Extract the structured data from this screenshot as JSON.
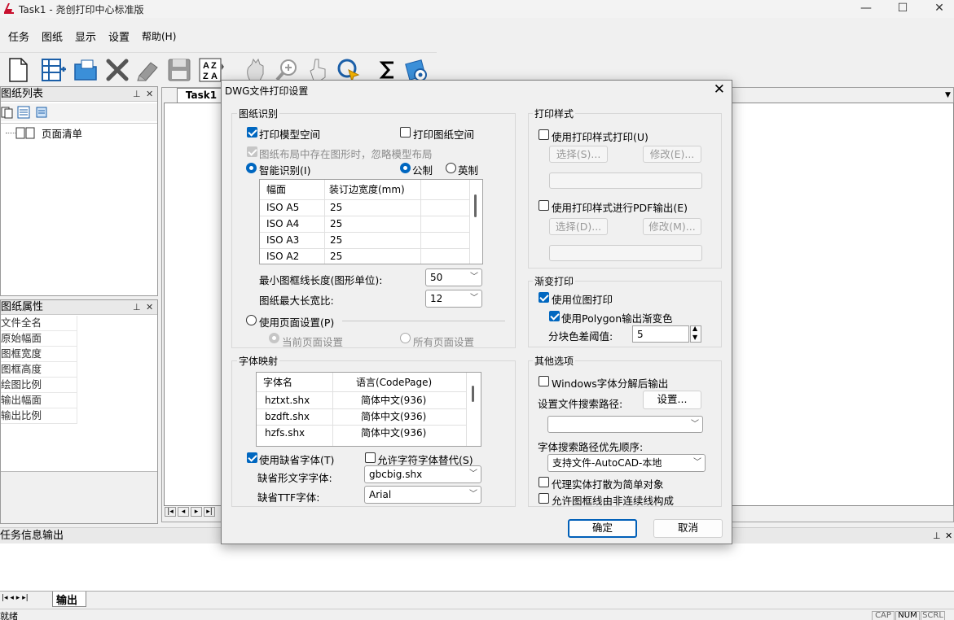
{
  "window": {
    "title": "Task1 - 尧创打印中心标准版",
    "minimize": "—",
    "maximize": "☐",
    "close": "✕"
  },
  "menu": [
    "任务",
    "图纸",
    "显示",
    "设置",
    "帮助(H)"
  ],
  "toolbar": {
    "icons": [
      "new-icon",
      "add-drawing-icon",
      "open-folder-icon",
      "delete-icon",
      "edit-icon",
      "save-icon",
      "sort-az-icon",
      "hand-icon",
      "zoom-in-icon",
      "pointer-icon",
      "select-icon",
      "sum-icon",
      "print-icon"
    ],
    "sort_label": "A Z"
  },
  "left_panel": {
    "title": "图纸列表",
    "pin": "⊥",
    "close": "✕",
    "tree_item": "页面清单"
  },
  "props_panel": {
    "title": "图纸属性",
    "pin": "⊥",
    "close": "✕",
    "rows": [
      "文件全名",
      "原始幅面",
      "图框宽度",
      "图框高度",
      "绘图比例",
      "输出幅面",
      "输出比例"
    ]
  },
  "doc": {
    "tab": "Task1"
  },
  "output": {
    "title": "任务信息输出",
    "tab": "输出",
    "pin": "⊥",
    "close": "✕"
  },
  "status": {
    "text": "就绪",
    "cells": [
      "CAP",
      "NUM",
      "SCRL"
    ]
  },
  "dialog": {
    "title": "DWG文件打印设置",
    "close": "✕",
    "recog": {
      "label": "图纸识别",
      "model_space": "打印模型空间",
      "paper_space": "打印图纸空间",
      "ignore_model": "图纸布局中存在图形时，忽略模型布局",
      "smart": "智能识别(I)",
      "metric": "公制",
      "imperial": "英制",
      "table_headers": [
        "幅面",
        "装订边宽度(mm)"
      ],
      "table_rows": [
        {
          "size": "ISO A5",
          "width": "25"
        },
        {
          "size": "ISO A4",
          "width": "25"
        },
        {
          "size": "ISO A3",
          "width": "25"
        },
        {
          "size": "ISO A2",
          "width": "25"
        }
      ],
      "min_frame_label": "最小图框线长度(图形单位):",
      "min_frame_value": "50",
      "max_ratio_label": "图纸最大长宽比:",
      "max_ratio_value": "12",
      "use_page_setup": "使用页面设置(P)",
      "current_page": "当前页面设置",
      "all_pages": "所有页面设置"
    },
    "font": {
      "label": "字体映射",
      "headers": [
        "字体名",
        "语言(CodePage)"
      ],
      "rows": [
        {
          "name": "hztxt.shx",
          "lang": "简体中文(936)"
        },
        {
          "name": "bzdft.shx",
          "lang": "简体中文(936)"
        },
        {
          "name": "hzfs.shx",
          "lang": "简体中文(936)"
        }
      ],
      "use_default": "使用缺省字体(T)",
      "allow_replace": "允许字符字体替代(S)",
      "default_shape_label": "缺省形文字字体:",
      "default_shape_value": "gbcbig.shx",
      "default_ttf_label": "缺省TTF字体:",
      "default_ttf_value": "Arial"
    },
    "style": {
      "label": "打印样式",
      "use_style": "使用打印样式打印(U)",
      "select1": "选择(S)...",
      "modify1": "修改(E)...",
      "use_pdf": "使用打印样式进行PDF输出(E)",
      "select2": "选择(D)...",
      "modify2": "修改(M)..."
    },
    "gradient": {
      "label": "渐变打印",
      "bitmap": "使用位图打印",
      "polygon": "使用Polygon输出渐变色",
      "threshold_label": "分块色差阈值:",
      "threshold_value": "5"
    },
    "other": {
      "label": "其他选项",
      "windows_font": "Windows字体分解后输出",
      "search_path_label": "设置文件搜索路径:",
      "settings_btn": "设置...",
      "priority_label": "字体搜索路径优先顺序:",
      "priority_value": "支持文件-AutoCAD-本地",
      "proxy": "代理实体打散为简单对象",
      "discontinuous": "允许图框线由非连续线构成"
    },
    "ok": "确定",
    "cancel": "取消"
  }
}
